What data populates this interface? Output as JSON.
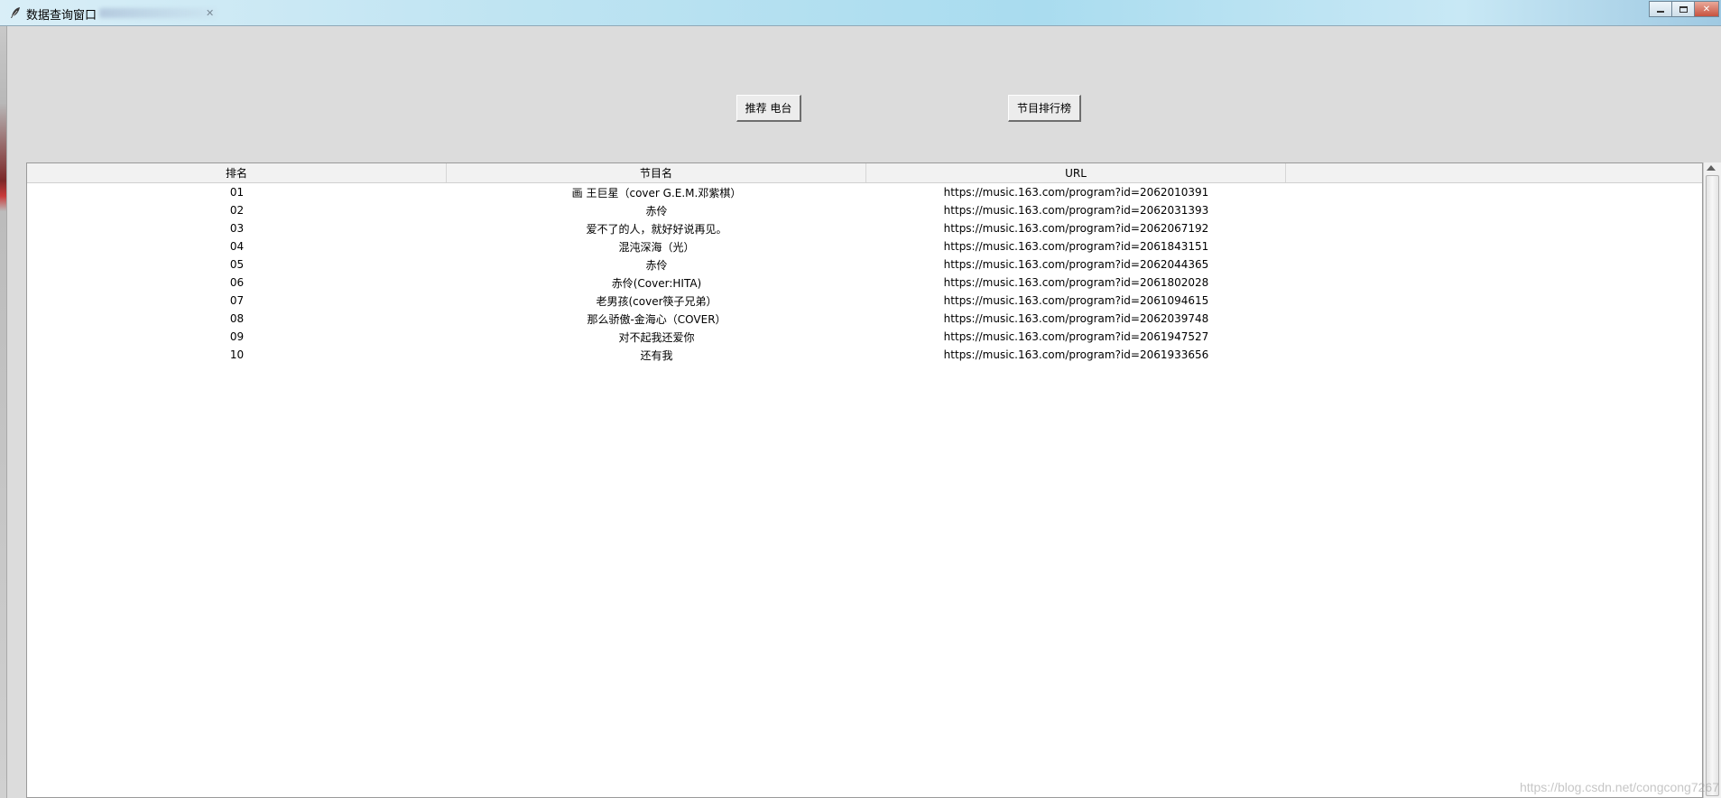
{
  "window": {
    "title": "数据查询窗口",
    "controls": {
      "minimize": "▭",
      "maximize": "□",
      "close": "✕"
    }
  },
  "toolbar": {
    "recommend_label": "推荐 电台",
    "rank_label": "节目排行榜"
  },
  "table": {
    "headers": [
      "排名",
      "节目名",
      "URL"
    ],
    "rows": [
      {
        "rank": "01",
        "name": "画 王巨星（cover G.E.M.邓紫棋）",
        "url": "https://music.163.com/program?id=2062010391"
      },
      {
        "rank": "02",
        "name": "赤伶",
        "url": "https://music.163.com/program?id=2062031393"
      },
      {
        "rank": "03",
        "name": "爱不了的人，就好好说再见。",
        "url": "https://music.163.com/program?id=2062067192"
      },
      {
        "rank": "04",
        "name": "混沌深海（光）",
        "url": "https://music.163.com/program?id=2061843151"
      },
      {
        "rank": "05",
        "name": "赤伶",
        "url": "https://music.163.com/program?id=2062044365"
      },
      {
        "rank": "06",
        "name": "赤伶(Cover:HITA)",
        "url": "https://music.163.com/program?id=2061802028"
      },
      {
        "rank": "07",
        "name": "老男孩(cover筷子兄弟）",
        "url": "https://music.163.com/program?id=2061094615"
      },
      {
        "rank": "08",
        "name": "那么骄傲-金海心（COVER）",
        "url": "https://music.163.com/program?id=2062039748"
      },
      {
        "rank": "09",
        "name": "对不起我还爱你",
        "url": "https://music.163.com/program?id=2061947527"
      },
      {
        "rank": "10",
        "name": "还有我",
        "url": "https://music.163.com/program?id=2061933656"
      }
    ]
  },
  "watermark": "https://blog.csdn.net/congcong7267"
}
